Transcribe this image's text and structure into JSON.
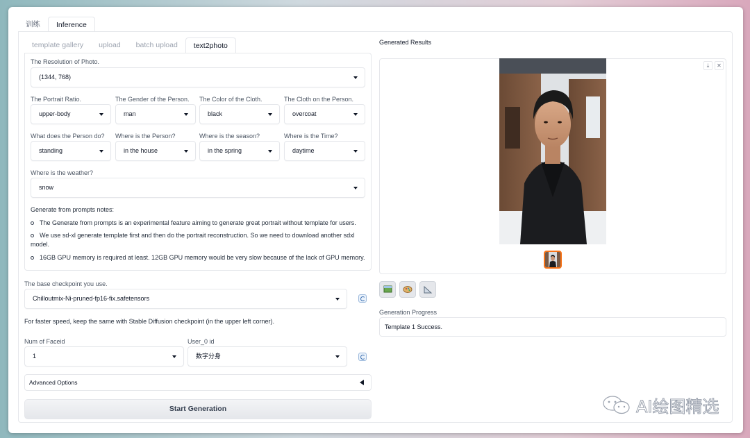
{
  "top_tabs": [
    {
      "label": "训练",
      "active": false
    },
    {
      "label": "Inference",
      "active": true
    }
  ],
  "sub_tabs": [
    {
      "label": "template gallery",
      "active": false
    },
    {
      "label": "upload",
      "active": false
    },
    {
      "label": "batch upload",
      "active": false
    },
    {
      "label": "text2photo",
      "active": true
    }
  ],
  "form": {
    "resolution": {
      "label": "The Resolution of Photo.",
      "value": "(1344, 768)"
    },
    "portrait_ratio": {
      "label": "The Portrait Ratio.",
      "value": "upper-body"
    },
    "gender": {
      "label": "The Gender of the Person.",
      "value": "man"
    },
    "cloth_color": {
      "label": "The Color of the Cloth.",
      "value": "black"
    },
    "cloth": {
      "label": "The Cloth on the Person.",
      "value": "overcoat"
    },
    "action": {
      "label": "What does the Person do?",
      "value": "standing"
    },
    "location": {
      "label": "Where is the Person?",
      "value": "in the house"
    },
    "season": {
      "label": "Where is the season?",
      "value": "in the spring"
    },
    "time": {
      "label": "Where is the Time?",
      "value": "daytime"
    },
    "weather": {
      "label": "Where is the weather?",
      "value": "snow"
    }
  },
  "notes": {
    "title": "Generate from prompts notes:",
    "items": [
      "The Generate from prompts is an experimental feature aiming to generate great portrait without template for users.",
      "We use sd-xl generate template first and then do the portrait reconstruction. So we need to download another sdxl model.",
      "16GB GPU memory is required at least. 12GB GPU memory would be very slow because of the lack of GPU memory."
    ]
  },
  "checkpoint": {
    "label": "The base checkpoint you use.",
    "value": "Chilloutmix-Ni-pruned-fp16-fix.safetensors",
    "hint": "For faster speed, keep the same with Stable Diffusion checkpoint (in the upper left corner)."
  },
  "faceid": {
    "label": "Num of Faceid",
    "value": "1"
  },
  "user_id": {
    "label": "User_0 id",
    "value": "数字分身"
  },
  "advanced_options": "Advanced Options",
  "start_button": "Start Generation",
  "results": {
    "label": "Generated Results",
    "download_icon": "⤓",
    "close_icon": "✕"
  },
  "progress": {
    "label": "Generation Progress",
    "value": "Template 1 Success."
  },
  "watermark": "AI绘图精选",
  "colors": {
    "accent_thumb_border": "#f97316",
    "start_button_bg": "#e5e7eb"
  }
}
